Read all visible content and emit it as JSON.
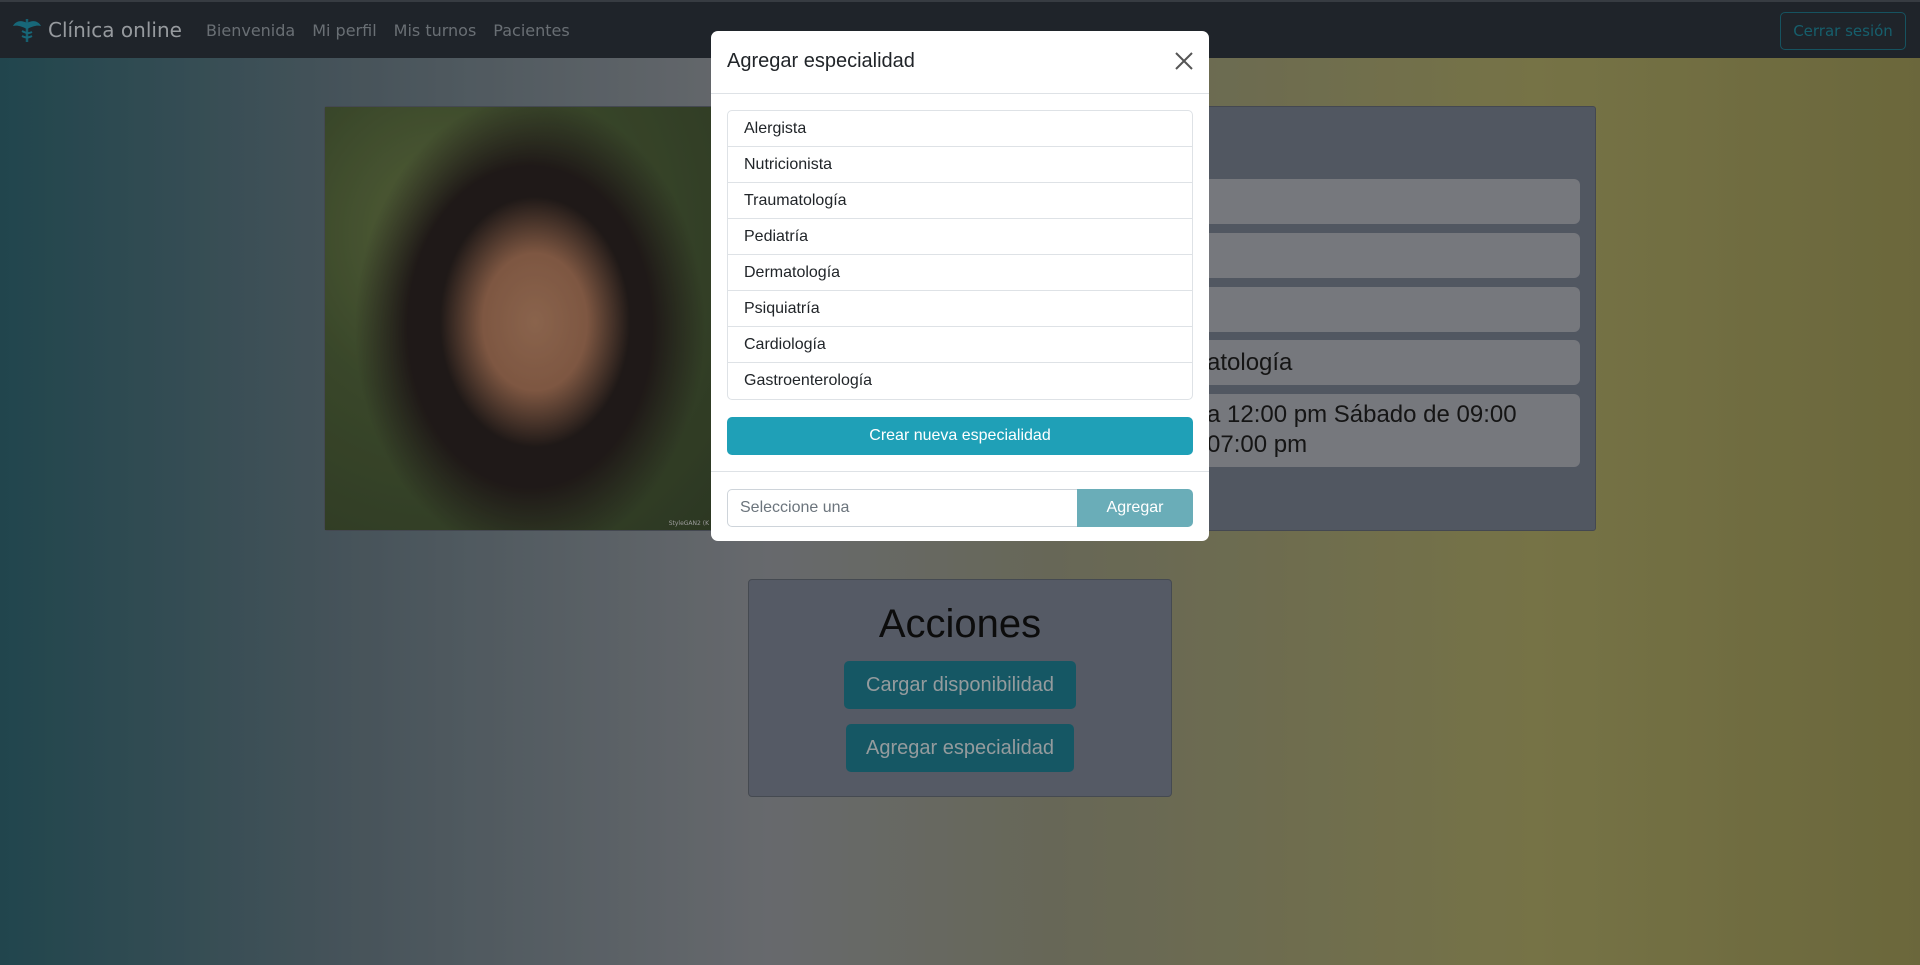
{
  "navbar": {
    "brand": "Clínica online",
    "links": [
      "Bienvenida",
      "Mi perfil",
      "Mis turnos",
      "Pacientes"
    ],
    "logout": "Cerrar sesión"
  },
  "profile": {
    "photo_caption": "StyleGAN2 (K",
    "rows": [
      "",
      "",
      "",
      "atología",
      "a 12:00 pm Sábado de 09:00",
      "07:00 pm"
    ]
  },
  "actions": {
    "title": "Acciones",
    "load_availability": "Cargar disponibilidad",
    "add_specialty": "Agregar especialidad"
  },
  "modal": {
    "title": "Agregar especialidad",
    "specialties": [
      "Alergista",
      "Nutricionista",
      "Traumatología",
      "Pediatría",
      "Dermatología",
      "Psiquiatría",
      "Cardiología",
      "Gastroenterología"
    ],
    "create_button": "Crear nueva especialidad",
    "select_placeholder": "Seleccione una",
    "add_button": "Agregar"
  },
  "colors": {
    "accent": "#1fa0b7",
    "add_button": "#6aadb8",
    "navbar": "#2a3039"
  }
}
